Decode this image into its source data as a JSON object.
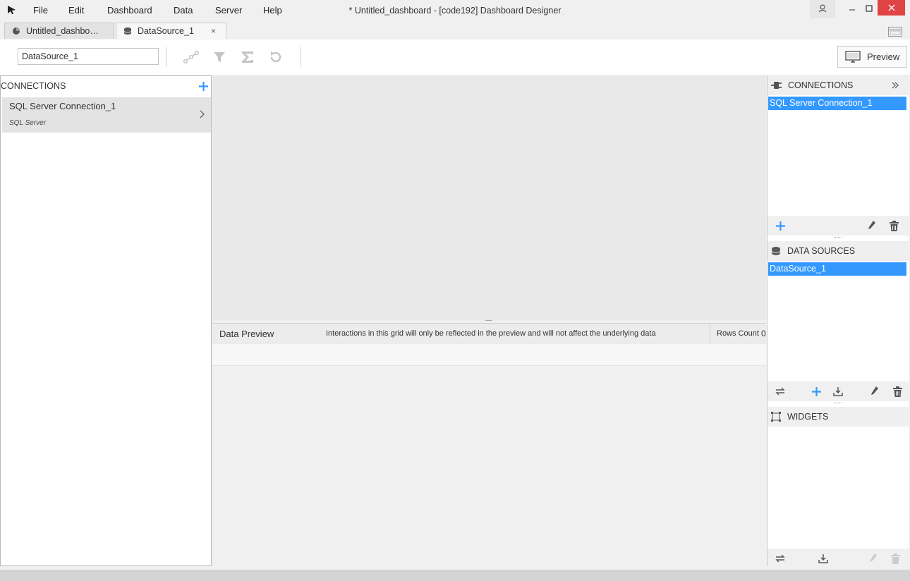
{
  "window": {
    "title": "* Untitled_dashboard - [code192] Dashboard Designer",
    "menu": [
      "File",
      "Edit",
      "Dashboard",
      "Data",
      "Server",
      "Help"
    ]
  },
  "tabs": [
    {
      "label": "Untitled_dashbo…",
      "icon": "pie-chart-icon",
      "active": false
    },
    {
      "label": "DataSource_1",
      "icon": "database-icon",
      "active": true,
      "close": "×"
    }
  ],
  "toolbar": {
    "datasource_name": "DataSource_1",
    "preview_label": "Preview"
  },
  "left_panel": {
    "header": "CONNECTIONS",
    "items": [
      {
        "name": "SQL Server Connection_1",
        "type": "SQL Server"
      }
    ]
  },
  "data_preview": {
    "title": "Data Preview",
    "notice": "Interactions in this grid will only be reflected in the preview and will not affect the underlying data",
    "rows_count_label": "Rows Count",
    "rows_count": "0"
  },
  "right_panel": {
    "connections": {
      "header": "CONNECTIONS",
      "selected": "SQL Server Connection_1"
    },
    "data_sources": {
      "header": "DATA SOURCES",
      "selected": "DataSource_1"
    },
    "widgets": {
      "header": "WIDGETS"
    }
  },
  "colors": {
    "accent": "#3399ff",
    "close_button": "#e04343"
  }
}
